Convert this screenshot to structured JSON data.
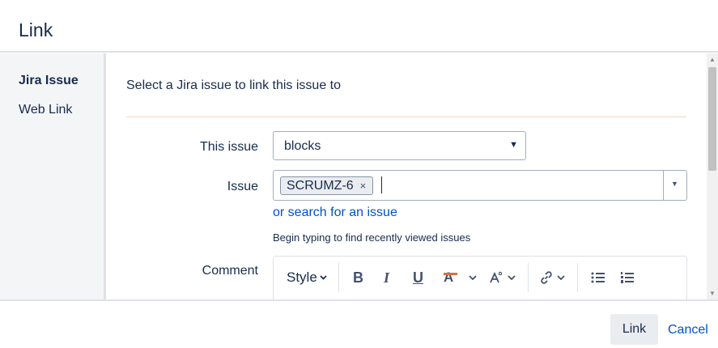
{
  "dialog": {
    "title": "Link"
  },
  "sidebar": {
    "items": [
      {
        "label": "Jira Issue",
        "active": true
      },
      {
        "label": "Web Link",
        "active": false
      }
    ]
  },
  "main": {
    "intro": "Select a Jira issue to link this issue to",
    "this_issue": {
      "label": "This issue",
      "value": "blocks"
    },
    "issue": {
      "label": "Issue",
      "selected": [
        "SCRUMZ-6"
      ],
      "remove_glyph": "×"
    },
    "search_link": "or search for an issue",
    "hint": "Begin typing to find recently viewed issues",
    "comment": {
      "label": "Comment",
      "toolbar": {
        "style": "Style",
        "bold": "B",
        "italic": "I",
        "underline": "U",
        "text_color": "A",
        "text_color_bar": "#de6d3d"
      }
    }
  },
  "footer": {
    "link_button": "Link",
    "cancel": "Cancel"
  },
  "icons": {
    "select_arrow": "triangle-down-icon",
    "picker_dropdown": "triangle-down-icon",
    "chevron": "chevron-down-icon",
    "more_formatting": "text-formatting-icon",
    "link": "link-icon",
    "bullet_list": "bullet-list-icon",
    "numbered_list": "numbered-list-icon"
  },
  "colors": {
    "link": "#0052cc",
    "text": "#172b4d",
    "sidebar_bg": "#f4f5f7",
    "divider": "#f0d9c8"
  }
}
